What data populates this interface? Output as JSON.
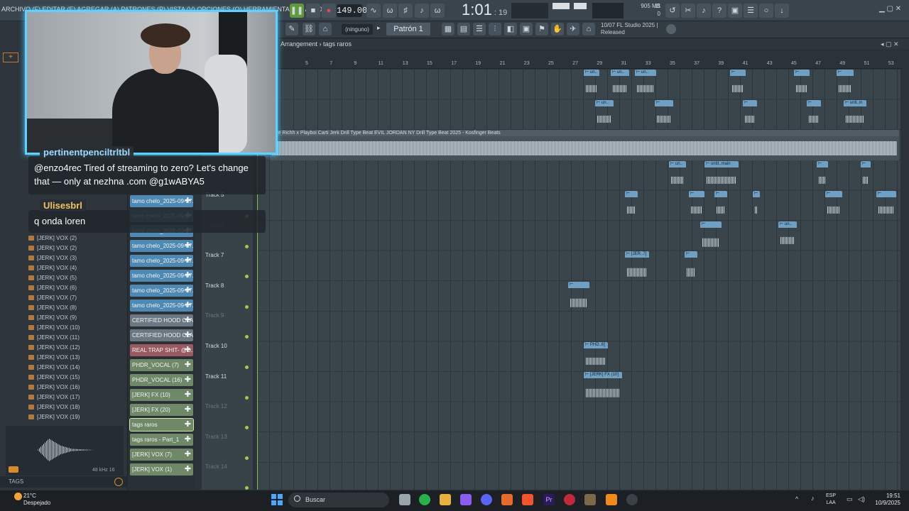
{
  "app": {
    "menu_text": "ARCHIVO (F)  EDITAR (E)  AGREGAR (A)  PATRONES (P)  VISTA (V)  OPCIONES (O)  HERRAMIENTAS (T)  AYUDA",
    "track_hint": "Track 3",
    "bpm": "149.000",
    "time_main": "1:01",
    "time_sub": "19",
    "cpu_label": "11",
    "mem_label": "905 MB",
    "mem_sub": "0",
    "none_select": "(ninguno)",
    "pattern": "Patrón 1",
    "hint_line1": "10/07  FL Studio 2025 |",
    "hint_line2": "Released",
    "arrangement_path": "Arrangement › tags raros",
    "colors": {
      "accent": "#5ed2ff",
      "led": "#9ccc4a",
      "playhead": "#7cc242"
    }
  },
  "ruler": {
    "ticks": [
      "5",
      "7",
      "9",
      "11",
      "13",
      "15",
      "17",
      "19",
      "21",
      "23",
      "25",
      "27",
      "29",
      "31",
      "33",
      "35",
      "37",
      "39",
      "41",
      "43",
      "45",
      "47",
      "49",
      "51",
      "53"
    ]
  },
  "browser": {
    "items": [
      "[JERK] VOX (2)",
      "[JERK] VOX (2)",
      "[JERK] VOX (3)",
      "[JERK] VOX (4)",
      "[JERK] VOX (5)",
      "[JERK] VOX (6)",
      "[JERK] VOX (7)",
      "[JERK] VOX (8)",
      "[JERK] VOX (9)",
      "[JERK] VOX (10)",
      "[JERK] VOX (11)",
      "[JERK] VOX (12)",
      "[JERK] VOX (13)",
      "[JERK] VOX (14)",
      "[JERK] VOX (15)",
      "[JERK] VOX (16)",
      "[JERK] VOX (17)",
      "[JERK] VOX (18)",
      "[JERK] VOX (19)"
    ],
    "khz": "48 kHz 16",
    "tags_label": "TAGS"
  },
  "cliplist": {
    "items": [
      {
        "label": "tamo chelo_2025-09-07...",
        "style": "blue"
      },
      {
        "label": "tamo chelo_2025-09-07...",
        "style": "blue"
      },
      {
        "label": "tamo chelo_2025-09-07...",
        "style": "blue"
      },
      {
        "label": "tamo chelo_2025-09-07...",
        "style": "blue"
      },
      {
        "label": "tamo chelo_2025-09-07...",
        "style": "blue"
      },
      {
        "label": "tamo chelo_2025-09-07...",
        "style": "blue"
      },
      {
        "label": "tamo chelo_2025-09-07...",
        "style": "blue"
      },
      {
        "label": "tamo chelo_2025-09-07...",
        "style": "blue"
      },
      {
        "label": "CERTIFIED HOOD CLAS...",
        "style": "gray"
      },
      {
        "label": "CERTIFIED HOOD CLAS...",
        "style": "gray"
      },
      {
        "label": "REAL TRAP SHIT- @D...",
        "style": "red"
      },
      {
        "label": "PHDR_VOCAL (7)",
        "style": "green"
      },
      {
        "label": "PHDR_VOCAL (16)",
        "style": "green"
      },
      {
        "label": "[JERK] FX (10)",
        "style": "green"
      },
      {
        "label": "[JERK] FX (20)",
        "style": "green"
      },
      {
        "label": "tags raros",
        "style": "green"
      },
      {
        "label": "tags raros - Part_1",
        "style": "green"
      },
      {
        "label": "[JERK] VOX (7)",
        "style": "green"
      },
      {
        "label": "[JERK] VOX (1)",
        "style": "green"
      }
    ]
  },
  "tracks": {
    "names": [
      "Track 5",
      "Track 6",
      "Track 7",
      "Track 8",
      "Track 9",
      "Track 10",
      "Track 11",
      "Track 12",
      "Track 13",
      "Track 14"
    ],
    "dim": [
      false,
      true,
      false,
      false,
      true,
      false,
      false,
      true,
      true,
      true
    ]
  },
  "playlist": {
    "big_clip_label": "Kyle Richh x Playboi Carti Jerk Drill Type Beat EVIL JORDAN  NY Drill Type Beat 2025 - Kosfinger Beats",
    "clip_labels": {
      "un": "un..",
      "un_main": "untit..main",
      "jer7": "[JER..7]",
      "phd6": "PHD..6]",
      "jerkfx10": "[JERK] FX (10]",
      "untm": "unti..in"
    }
  },
  "chat": {
    "messages": [
      {
        "user": "pertinentpenciltrltbl",
        "text": "@enzo4rec Tired of streaming to zero? Let's change that — only at nezhna .com @g1wABYA5"
      },
      {
        "user": "Ulisesbrl",
        "text": "q onda loren"
      }
    ]
  },
  "taskbar": {
    "temp": "21°C",
    "weather": "Despejado",
    "search": "Buscar",
    "lang1": "ESP",
    "lang2": "LAA",
    "time": "19:51",
    "date": "10/9/2025"
  }
}
